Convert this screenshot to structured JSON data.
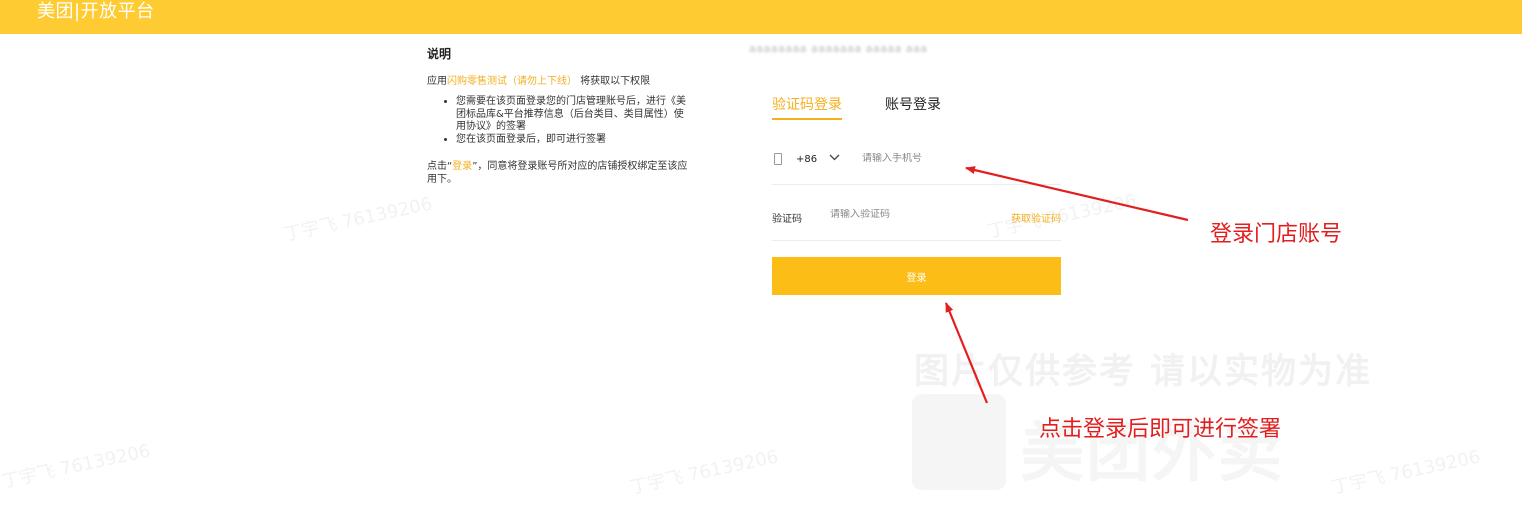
{
  "header": {
    "brand": "美团|开放平台",
    "bg_color": "#ffcb33"
  },
  "explanation": {
    "heading": "说明",
    "intro_prefix": "应用",
    "app_name": "闪购零售测试（请勿上下线）",
    "intro_suffix": " 将获取以下权限",
    "bullets": [
      "您需要在该页面登录您的门店管理账号后，进行《美团标品库&平台推荐信息（后台类目、类目属性）使用协议》的签署",
      "您在该页面登录后，即可进行签署"
    ],
    "consent_prefix": "点击“",
    "consent_link": "登录",
    "consent_suffix": "”，同意将登录账号所对应的店铺授权绑定至该应用下。"
  },
  "login": {
    "account_blurred": "aaaaaaaa aaaaaaa aaaaa aaa",
    "tabs": [
      {
        "label": "验证码登录",
        "active": true
      },
      {
        "label": "账号登录",
        "active": false
      }
    ],
    "phone": {
      "country_code": "+86",
      "placeholder": "请输入手机号",
      "value": ""
    },
    "code": {
      "label": "验证码",
      "placeholder": "请输入验证码",
      "value": "",
      "get_code_label": "获取验证码"
    },
    "submit_label": "登录",
    "accent_color": "#f6ae1f",
    "button_color": "#fbbd16"
  },
  "annotations": {
    "login_store_account": "登录门店账号",
    "click_login_then_sign": "点击登录后即可进行签署",
    "color": "#e21f1f"
  },
  "watermark": {
    "reference_notice": "图片仅供参考 请以实物为准",
    "brand": "美团外卖",
    "user_tag": "丁宇飞 76139206"
  },
  "icons": {
    "phone": "phone-icon",
    "dropdown": "chevron-down-icon",
    "arrow": "arrow-icon"
  }
}
